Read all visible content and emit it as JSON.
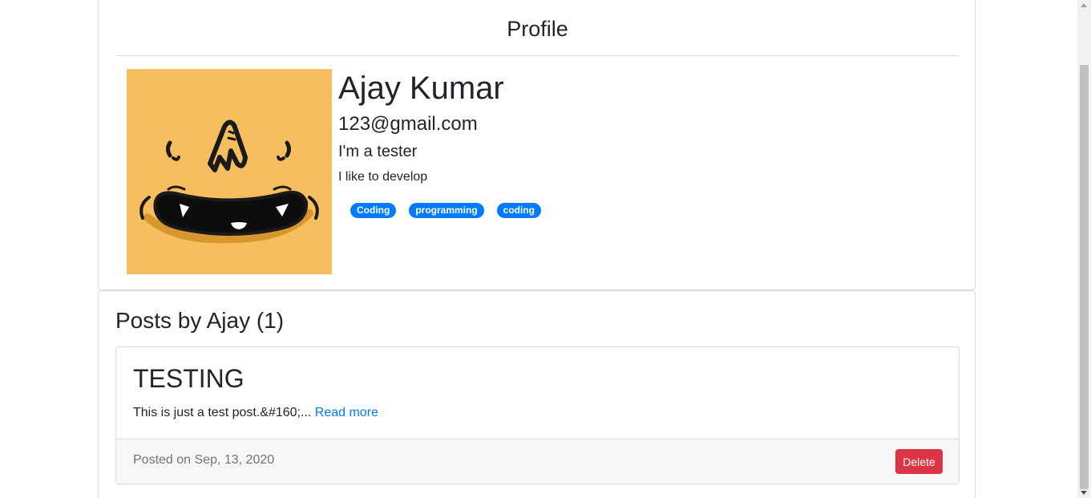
{
  "profile": {
    "header_title": "Profile",
    "name": "Ajay Kumar",
    "email": "123@gmail.com",
    "title": "I'm a tester",
    "bio": "I like to develop",
    "tags": [
      "Coding",
      "programming",
      "coding"
    ],
    "avatar_icon": "smiling-face-avatar",
    "avatar_color": "#f6be5e"
  },
  "posts": {
    "heading": "Posts by Ajay (1)",
    "items": [
      {
        "title": "TESTING",
        "excerpt": "This is just a test post.&#160;...",
        "read_more": "Read more",
        "posted_on": "Posted on Sep, 13, 2020",
        "delete_label": "Delete"
      }
    ]
  },
  "colors": {
    "primary": "#007bff",
    "danger": "#dc3545",
    "footer_bg": "#f7f7f7"
  }
}
